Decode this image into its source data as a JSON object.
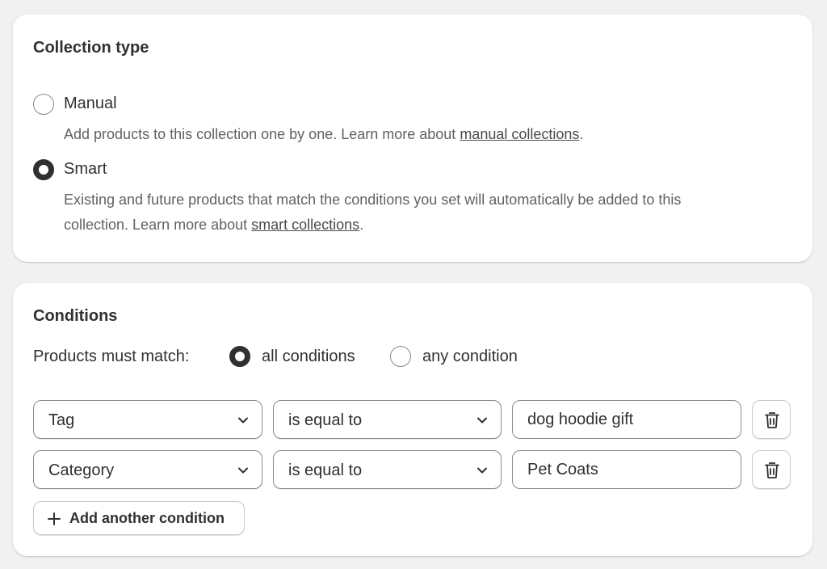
{
  "collection_type": {
    "title": "Collection type",
    "manual": {
      "label": "Manual",
      "desc_prefix": "Add products to this collection one by one. Learn more about ",
      "desc_link": "manual collections",
      "desc_suffix": ".",
      "checked": false
    },
    "smart": {
      "label": "Smart",
      "desc_line1": "Existing and future products that match the conditions you set will automatically be added to this",
      "desc_prefix": "collection. Learn more about ",
      "desc_link": "smart collections",
      "desc_suffix": ".",
      "checked": true
    }
  },
  "conditions": {
    "title": "Conditions",
    "match_label": "Products must match:",
    "match_all": "all conditions",
    "match_any": "any condition",
    "selected_match": "all",
    "rows": [
      {
        "field": "Tag",
        "operator": "is equal to",
        "value": "dog hoodie gift"
      },
      {
        "field": "Category",
        "operator": "is equal to",
        "value": "Pet Coats"
      }
    ],
    "add_label": "Add another condition"
  }
}
